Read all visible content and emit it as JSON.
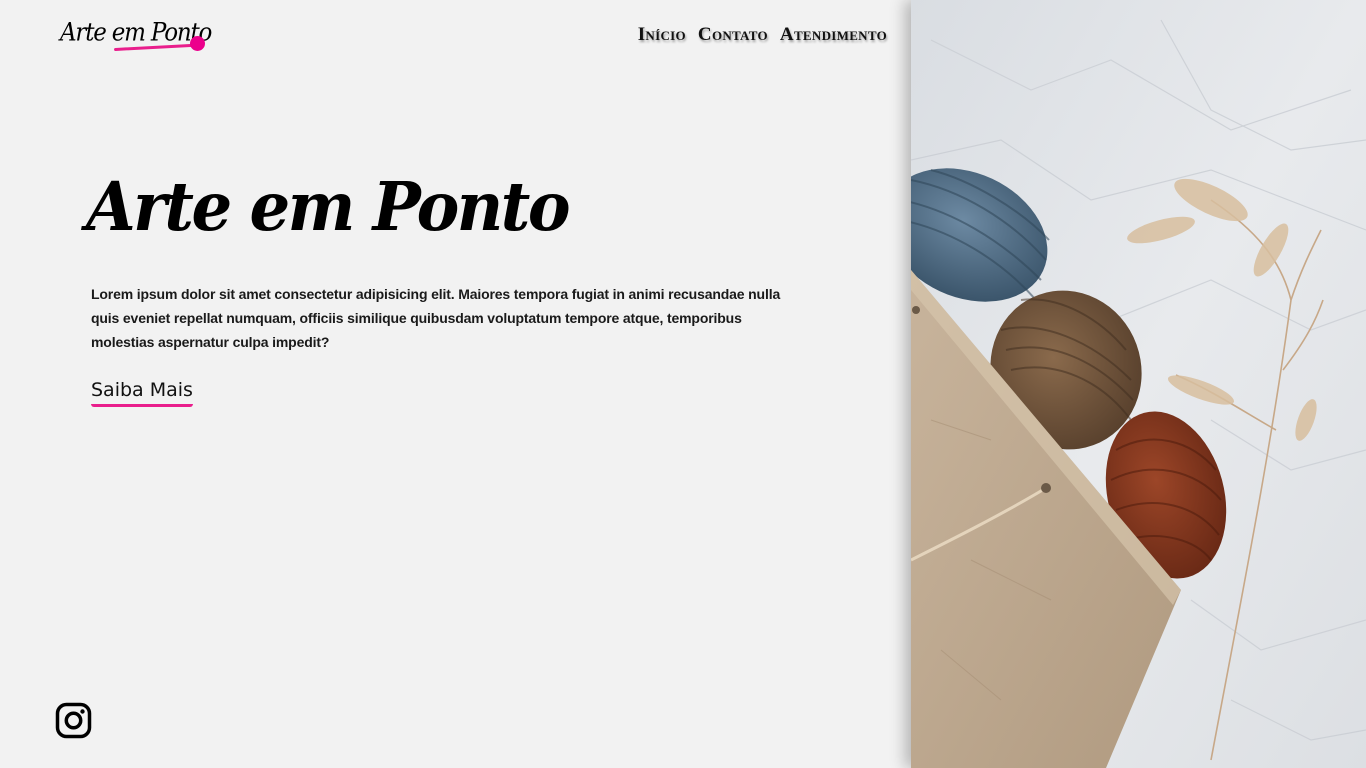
{
  "header": {
    "logo_text": "Arte em Ponto",
    "nav": [
      {
        "label": "Início"
      },
      {
        "label": "Contato"
      },
      {
        "label": "Atendimento"
      }
    ]
  },
  "hero": {
    "title": "Arte em Ponto",
    "description": "Lorem ipsum dolor sit amet consectetur adipisicing elit. Maiores tempora fugiat in animi recusandae nulla quis eveniet repellat numquam, officiis similique quibusdam voluptatum tempore atque, temporibus molestias aspernatur culpa impedit?",
    "cta_label": "Saiba Mais"
  },
  "social": {
    "instagram_icon": "instagram-icon"
  },
  "image": {
    "subject": "yarn-balls-in-paper-bag-with-dried-grass"
  },
  "colors": {
    "background": "#f2f2f2",
    "accent": "#ec008c",
    "text": "#000000"
  }
}
